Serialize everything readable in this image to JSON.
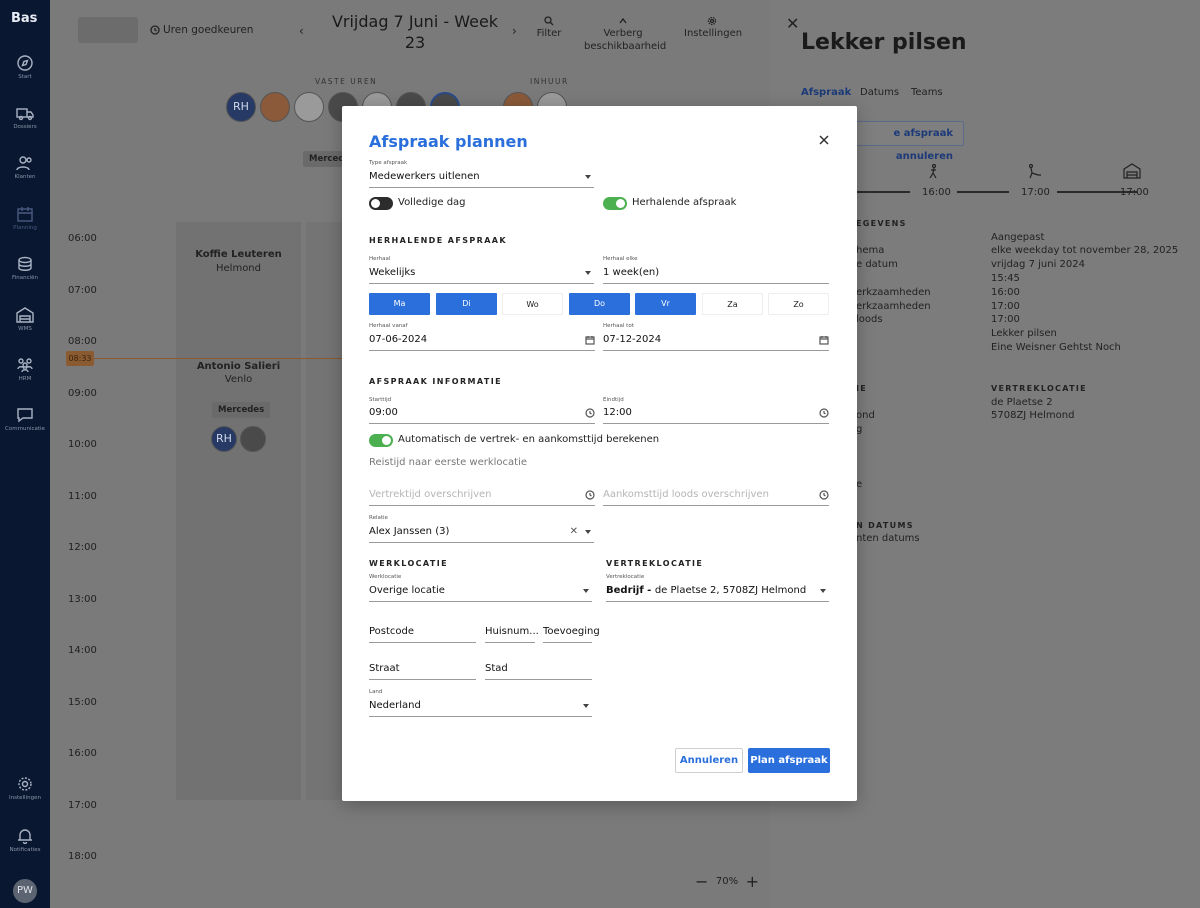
{
  "nav": {
    "logo": "Bas",
    "items": [
      {
        "label": "Start",
        "icon": "compass-icon"
      },
      {
        "label": "Dossiers",
        "icon": "moving-truck-icon"
      },
      {
        "label": "Klanten",
        "icon": "users-icon"
      },
      {
        "label": "Planning",
        "icon": "calendar-icon"
      },
      {
        "label": "Financiën",
        "icon": "coins-icon"
      },
      {
        "label": "WMS",
        "icon": "warehouse-icon"
      },
      {
        "label": "HRM",
        "icon": "team-icon"
      },
      {
        "label": "Communicatie",
        "icon": "chat-icon"
      },
      {
        "label": "Instellingen",
        "icon": "gear-icon"
      },
      {
        "label": "Notificaties",
        "icon": "bell-icon"
      }
    ],
    "avatar_initials": "PW"
  },
  "calendar": {
    "uren_label": "Uren goedkeuren",
    "date_title": "Vrijdag 7 Juni - Week 23",
    "tools": [
      {
        "label": "Filter",
        "icon": "search-icon"
      },
      {
        "label": "Verberg beschikbaarheid",
        "icon": "chevron-up-icon"
      },
      {
        "label": "Instellingen",
        "icon": "gear-icon"
      }
    ],
    "group_vaste": "VASTE UREN",
    "group_inhuur": "INHUUR",
    "avatar_rh": "RH",
    "vehicle_chip": "Mercede",
    "times": [
      "06:00",
      "07:00",
      "08:00",
      "09:00",
      "10:00",
      "11:00",
      "12:00",
      "13:00",
      "14:00",
      "15:00",
      "16:00",
      "17:00",
      "18:00"
    ],
    "now_time": "08:33",
    "appointments": [
      {
        "title": "Koffie Leuteren",
        "sub": "Helmond"
      },
      {
        "title": "Antonio Salieri",
        "sub": "Venlo",
        "chip": "Mercedes",
        "avatar": "RH"
      }
    ],
    "zoom": "70%"
  },
  "detail": {
    "title": "Lekker pilsen",
    "tabs": [
      "Afspraak",
      "Datums",
      "Teams"
    ],
    "cancel_label": "e afspraak annuleren",
    "timeline": [
      "16:00",
      "17:00",
      "17:00"
    ],
    "section1": "EGEVENS",
    "left_rows": [
      "hema",
      "e datum",
      "",
      "erkzaamheden",
      "erkzaamheden",
      "loods"
    ],
    "values": [
      "Aangepast",
      "elke weekday tot november 28, 2025",
      "vrijdag 7 juni 2024",
      "15:45",
      "16:00",
      "17:00",
      "17:00",
      "Lekker pilsen",
      "Eine Weisner Gehtst Noch"
    ],
    "loc_left_header": "IE",
    "loc_left": [
      "ond",
      "g"
    ],
    "loc_right_header": "VERTREKLOCATIE",
    "loc_right": [
      "de Plaetse 2",
      "5708ZJ Helmond"
    ],
    "small_e": "e",
    "dates_header": "N DATUMS",
    "dates_text": "nten datums"
  },
  "modal": {
    "title": "Afspraak plannen",
    "type_label": "Type afspraak",
    "type_value": "Medewerkers uitlenen",
    "toggle_fullday": "Volledige dag",
    "toggle_recurring": "Herhalende afspraak",
    "sec_recurring": "HERHALENDE AFSPRAAK",
    "herhaal_label": "Herhaal",
    "herhaal_value": "Wekelijks",
    "herhaal_elke_label": "Herhaal elke",
    "herhaal_elke_value": "1 week(en)",
    "days": [
      {
        "label": "Ma",
        "on": true
      },
      {
        "label": "Di",
        "on": true
      },
      {
        "label": "Wo",
        "on": false
      },
      {
        "label": "Do",
        "on": true
      },
      {
        "label": "Vr",
        "on": true
      },
      {
        "label": "Za",
        "on": false
      },
      {
        "label": "Zo",
        "on": false
      }
    ],
    "from_label": "Herhaal vanaf",
    "from_value": "07-06-2024",
    "to_label": "Herhaal tot",
    "to_value": "07-12-2024",
    "sec_info": "AFSPRAAK INFORMATIE",
    "start_label": "Starttijd",
    "start_value": "09:00",
    "end_label": "Eindtijd",
    "end_value": "12:00",
    "toggle_auto": "Automatisch de vertrek- en aankomsttijd berekenen",
    "travel_hint": "Reistijd naar eerste werklocatie",
    "depart_placeholder": "Vertrektijd overschrijven",
    "arrive_placeholder": "Aankomsttijd loods overschrijven",
    "relatie_label": "Relatie",
    "relatie_value": "Alex Janssen (3)",
    "sec_werk": "WERKLOCATIE",
    "sec_vertrek": "VERTREKLOCATIE",
    "werk_label": "Werklocatie",
    "werk_value": "Overige locatie",
    "vertrek_label": "Vertreklocatie",
    "vertrek_bold": "Bedrijf - ",
    "vertrek_value": "de Plaetse 2, 5708ZJ Helmond",
    "postcode": "Postcode",
    "huisnummer": "Huisnum...",
    "toevoeging": "Toevoeging",
    "straat": "Straat",
    "stad": "Stad",
    "land_label": "Land",
    "land_value": "Nederland",
    "cancel": "Annuleren",
    "submit": "Plan afspraak"
  }
}
